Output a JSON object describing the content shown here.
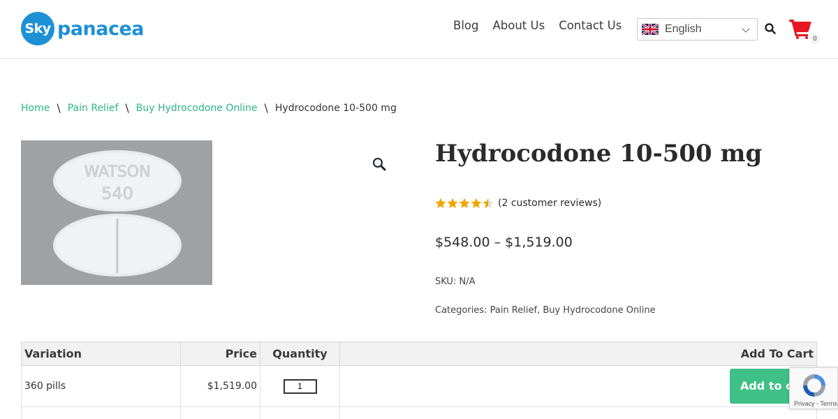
{
  "header": {
    "logo": {
      "sky": "Sky",
      "panacea": "panacea"
    },
    "nav": [
      "Blog",
      "About Us",
      "Contact Us"
    ],
    "language": {
      "selected": "English",
      "flag_icon": "uk-flag-icon"
    },
    "search_icon": "search-icon",
    "cart": {
      "icon": "cart-icon",
      "count": "0",
      "color": "#e8161f"
    }
  },
  "breadcrumb": {
    "items": [
      "Home",
      "Pain Relief",
      "Buy Hydrocodone Online"
    ],
    "current": "Hydrocodone 10-500 mg",
    "separator": "\\",
    "link_color": "#2bb584"
  },
  "product": {
    "image_text": {
      "line1": "WATSON",
      "line2": "540"
    },
    "title": "Hydrocodone 10-500 mg",
    "rating": {
      "value": 4.5,
      "max": 5,
      "reviews_text": "(2 customer reviews)",
      "star_color": "#f0a500"
    },
    "price_range": "$548.00 – $1,519.00",
    "sku_label": "SKU:",
    "sku_value": "N/A",
    "categories_label": "Categories:",
    "categories": [
      "Pain Relief",
      "Buy Hydrocodone Online"
    ]
  },
  "variations": {
    "headers": [
      "Variation",
      "Price",
      "Quantity",
      "Add To Cart"
    ],
    "rows": [
      {
        "variation": "360 pills",
        "price": "$1,519.00",
        "quantity": "1",
        "button": "Add to cart"
      }
    ],
    "button_color": "#3ec086"
  },
  "recaptcha": {
    "text": "Privacy - Terms"
  }
}
